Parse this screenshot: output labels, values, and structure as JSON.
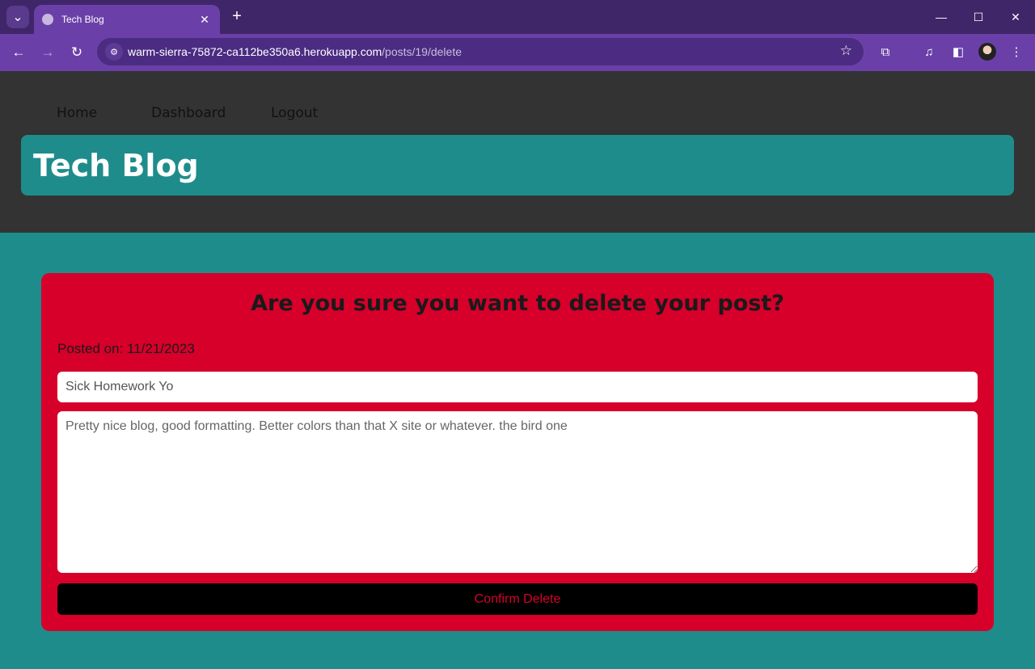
{
  "browser": {
    "tab_title": "Tech Blog",
    "url_host": "warm-sierra-75872-ca112be350a6.herokuapp.com",
    "url_path": "/posts/19/delete"
  },
  "nav": {
    "items": [
      {
        "label": "Home"
      },
      {
        "label": "Dashboard"
      },
      {
        "label": "Logout"
      }
    ]
  },
  "banner": {
    "title": "Tech Blog"
  },
  "delete_card": {
    "heading": "Are you sure you want to delete your post?",
    "posted_on": "Posted on: 11/21/2023",
    "title_value": "Sick Homework Yo",
    "body_value": "Pretty nice blog, good formatting. Better colors than that X site or whatever. the bird one",
    "confirm_label": "Confirm Delete"
  },
  "colors": {
    "header_bg": "#333333",
    "accent_teal": "#1f8c8c",
    "card_red": "#d6002a",
    "browser_purple": "#6a40a8"
  },
  "icons": [
    "tab-search-icon",
    "globe-icon",
    "close-icon",
    "plus-icon",
    "minimize-icon",
    "maximize-icon",
    "back-icon",
    "forward-icon",
    "reload-icon",
    "site-info-icon",
    "star-icon",
    "extensions-icon",
    "media-icon",
    "sidepanel-icon",
    "menu-icon"
  ]
}
